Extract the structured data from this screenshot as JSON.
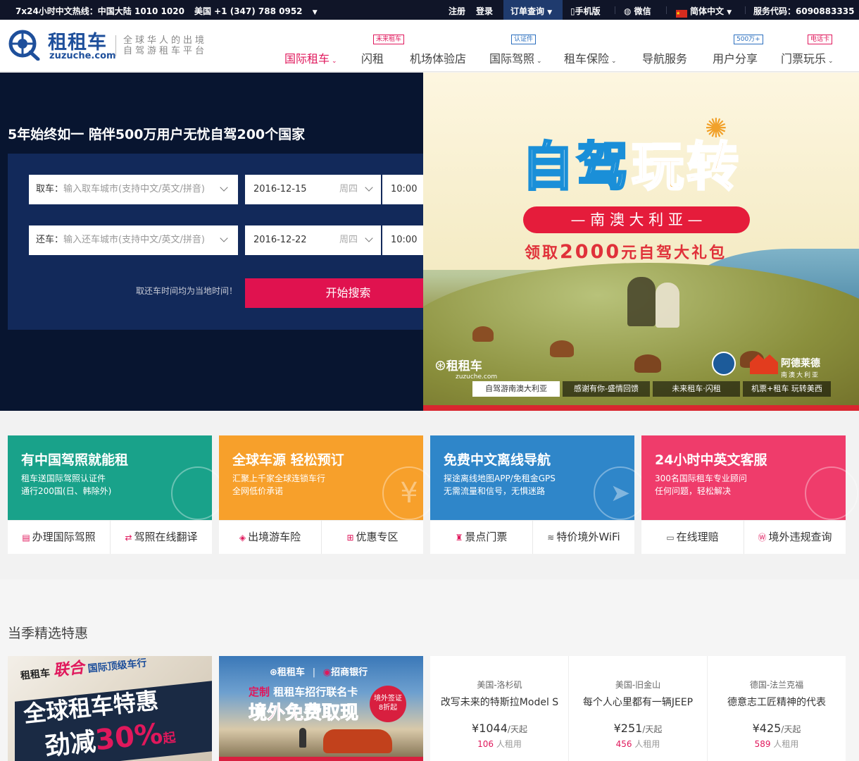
{
  "topbar": {
    "hotline": "7x24小时中文热线：",
    "china_phone": "中国大陆 1010 1020",
    "us_phone": "美国 +1 (347) 788 0952",
    "register": "注册",
    "login": "登录",
    "order_query": "订单查询",
    "mobile": "手机版",
    "wechat": "微信",
    "language": "简体中文",
    "service_code": "服务代码：6090883335"
  },
  "header": {
    "logo_cn": "租租车",
    "logo_en": "zuzuche.com",
    "slogan_line1": "全球华人的出境",
    "slogan_line2": "自驾游租车平台"
  },
  "nav": {
    "items": [
      {
        "label": "国际租车",
        "active": true,
        "dropdown": true
      },
      {
        "label": "闪租",
        "tag": "未来租车"
      },
      {
        "label": "机场体验店"
      },
      {
        "label": "国际驾照",
        "tag": "认证件",
        "dropdown": true
      },
      {
        "label": "租车保险",
        "dropdown": true
      },
      {
        "label": "导航服务"
      },
      {
        "label": "用户分享",
        "tag": "500万+"
      },
      {
        "label": "门票玩乐",
        "tag": "电话卡",
        "dropdown": true
      }
    ]
  },
  "hero": {
    "title": "5年始终如一 陪伴500万用户无忧自驾200个国家",
    "pickup_label": "取车：",
    "pickup_placeholder": "输入取车城市(支持中文/英文/拼音)",
    "pickup_date": "2016-12-15",
    "pickup_weekday": "周四",
    "pickup_time": "10:00",
    "return_label": "还车：",
    "return_placeholder": "输入还车城市(支持中文/英文/拼音)",
    "return_date": "2016-12-22",
    "return_weekday": "周四",
    "return_time": "10:00",
    "note": "取还车时间均为当地时间！",
    "search_button": "开始搜索"
  },
  "banner": {
    "headline_a": "自驾",
    "headline_b": "玩转",
    "ribbon": "— 南 澳 大 利 亚 —",
    "offer_prefix": "领取",
    "offer_amount": "2000",
    "offer_suffix": "元自驾大礼包",
    "logo_cn": "租租车",
    "logo_en": "zuzuche.com",
    "partner": "阿德莱德",
    "partner_sub": "南澳大利亚",
    "tabs": [
      "自驾游南澳大利亚",
      "感谢有你-盛情回馈",
      "未来租车·闪租",
      "机票+租车 玩转美西"
    ]
  },
  "features": [
    {
      "title": "有中国驾照就能租",
      "desc1": "租车送国际驾照认证件",
      "desc2": "通行200国(日、韩除外)",
      "color": "#19a28a",
      "links": [
        {
          "icon": "document-icon",
          "label": "办理国际驾照"
        },
        {
          "icon": "translate-icon",
          "label": "驾照在线翻译"
        }
      ]
    },
    {
      "title": "全球车源 轻松预订",
      "desc1": "汇聚上千家全球连锁车行",
      "desc2": "全网低价承诺",
      "color": "#f7a02b",
      "links": [
        {
          "icon": "shield-icon",
          "label": "出境游车险"
        },
        {
          "icon": "gift-icon",
          "label": "优惠专区"
        }
      ]
    },
    {
      "title": "免费中文离线导航",
      "desc1": "探途离线地图APP/免租金GPS",
      "desc2": "无需流量和信号，无惧迷路",
      "color": "#2f86c9",
      "links": [
        {
          "icon": "tower-icon",
          "label": "景点门票"
        },
        {
          "icon": "wifi-icon",
          "label": "特价境外WiFi"
        }
      ]
    },
    {
      "title": "24小时中英文客服",
      "desc1": "300名国际租车专业顾问",
      "desc2": "任何问题，轻松解决",
      "color": "#ef3c6b",
      "links": [
        {
          "icon": "monitor-icon",
          "label": "在线理赔"
        },
        {
          "icon": "violation-icon",
          "label": "境外违规查询"
        }
      ]
    }
  ],
  "deals_section": {
    "title": "当季精选特惠",
    "promo1": {
      "brand": "租租车",
      "union": "联合",
      "partner": "国际顶级车行",
      "headline": "全球租车特惠",
      "cut": "劲减",
      "percent": "30%",
      "suffix": "起"
    },
    "promo2": {
      "logo": "租租车",
      "bank": "招商银行",
      "line1_a": "定制",
      "line1_b": "租租车招行联名卡",
      "headline": "境外免费取现",
      "badge1": "境外签证",
      "badge2": "8折起"
    },
    "deals": [
      {
        "city": "美国-洛杉矶",
        "name": "改写未来的特斯拉Model S",
        "price": "¥1044",
        "unit": "/天起",
        "count": "106",
        "count_suffix": "人租用"
      },
      {
        "city": "美国-旧金山",
        "name": "每个人心里都有一辆JEEP",
        "price": "¥251",
        "unit": "/天起",
        "count": "456",
        "count_suffix": "人租用"
      },
      {
        "city": "德国-法兰克福",
        "name": "德意志工匠精神的代表",
        "price": "¥425",
        "unit": "/天起",
        "count": "589",
        "count_suffix": "人租用"
      }
    ]
  }
}
